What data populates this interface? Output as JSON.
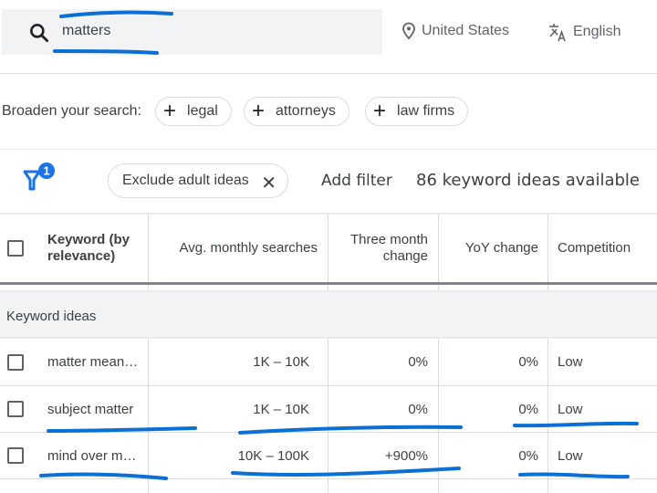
{
  "search": {
    "query": "matters",
    "icon": "search-icon"
  },
  "targeting": {
    "location": "United States",
    "location_icon": "location-pin-icon",
    "language": "English",
    "language_icon": "translate-icon"
  },
  "broaden": {
    "label": "Broaden your search:",
    "chips": [
      {
        "label": "legal",
        "icon": "plus-icon"
      },
      {
        "label": "attorneys",
        "icon": "plus-icon"
      },
      {
        "label": "law firms",
        "icon": "plus-icon"
      }
    ]
  },
  "filters": {
    "filter_icon": "filter-icon",
    "badge_count": "1",
    "active_chip": "Exclude adult ideas",
    "active_chip_icon": "close-icon",
    "add_filter_label": "Add filter",
    "ideas_available": "86 keyword ideas available",
    "accent_color": "#1a73e8"
  },
  "table": {
    "columns": [
      {
        "label": "Keyword (by relevance)"
      },
      {
        "label": "Avg. monthly searches"
      },
      {
        "label": "Three month change"
      },
      {
        "label": "YoY change"
      },
      {
        "label": "Competition"
      }
    ],
    "group_label": "Keyword ideas",
    "rows": [
      {
        "keyword": "matter mean…",
        "avg_monthly": "1K – 10K",
        "three_month": "0%",
        "yoy": "0%",
        "competition": "Low"
      },
      {
        "keyword": "subject matter",
        "avg_monthly": "1K – 10K",
        "three_month": "0%",
        "yoy": "0%",
        "competition": "Low"
      },
      {
        "keyword": "mind over m…",
        "avg_monthly": "10K – 100K",
        "three_month": "+900%",
        "yoy": "0%",
        "competition": "Low"
      }
    ]
  },
  "annotation_color": "#0b6fd6"
}
